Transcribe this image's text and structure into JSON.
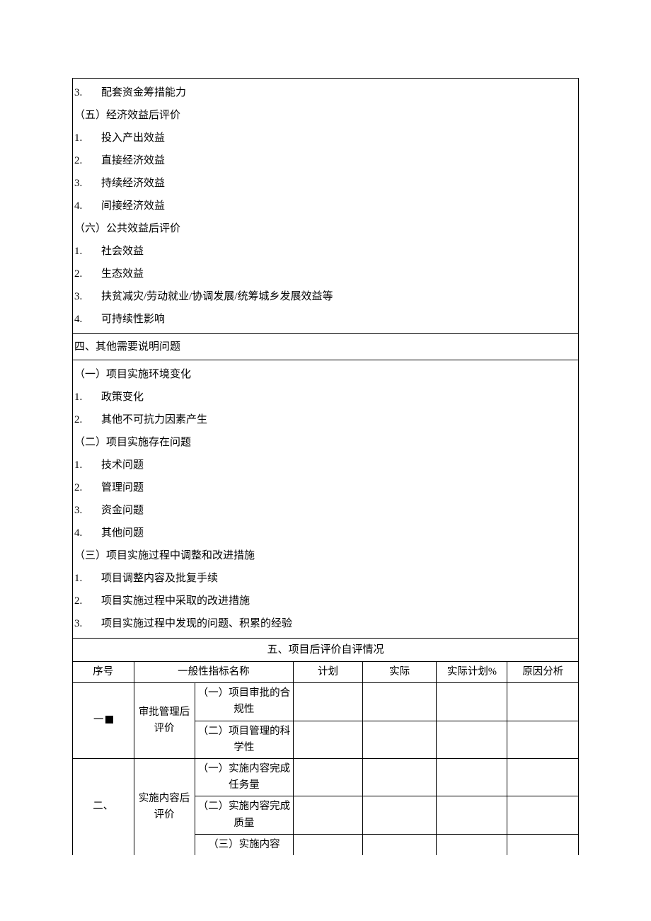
{
  "section3": {
    "item3": {
      "num": "3.",
      "text": "配套资金筹措能力"
    },
    "sub5": "（五）经济效益后评价",
    "s5_1": {
      "num": "1.",
      "text": "投入产出效益"
    },
    "s5_2": {
      "num": "2.",
      "text": "直接经济效益"
    },
    "s5_3": {
      "num": "3.",
      "text": "持续经济效益"
    },
    "s5_4": {
      "num": "4.",
      "text": "间接经济效益"
    },
    "sub6": "（六）公共效益后评价",
    "s6_1": {
      "num": "1.",
      "text": "社会效益"
    },
    "s6_2": {
      "num": "2.",
      "text": "生态效益"
    },
    "s6_3": {
      "num": "3.",
      "text": "扶贫减灾/劳动就业/协调发展/统筹城乡发展效益等"
    },
    "s6_4": {
      "num": "4.",
      "text": "可持续性影响"
    }
  },
  "section4": {
    "heading": "四、其他需要说明问题",
    "sub1": "（一）项目实施环境变化",
    "s1_1": {
      "num": "1.",
      "text": "政策变化"
    },
    "s1_2": {
      "num": "2.",
      "text": "其他不可抗力因素产生"
    },
    "sub2": "（二）项目实施存在问题",
    "s2_1": {
      "num": "1.",
      "text": "技术问题"
    },
    "s2_2": {
      "num": "2.",
      "text": "管理问题"
    },
    "s2_3": {
      "num": "3.",
      "text": "资金问题"
    },
    "s2_4": {
      "num": "4.",
      "text": "其他问题"
    },
    "sub3": "（三）项目实施过程中调整和改进措施",
    "s3_1": {
      "num": "1.",
      "text": "项目调整内容及批复手续"
    },
    "s3_2": {
      "num": "2.",
      "text": "项目实施过程中采取的改进措施"
    },
    "s3_3": {
      "num": "3.",
      "text": "项目实施过程中发现的问题、积累的经验"
    }
  },
  "section5": {
    "heading": "五、项目后评价自评情况",
    "headers": {
      "seq": "序号",
      "indicator": "一般性指标名称",
      "plan": "计划",
      "actual": "实际",
      "pct": "实际计划%",
      "reason": "原因分析"
    },
    "rows": [
      {
        "seq": "一",
        "category": "审批管理后评价",
        "indicators": [
          "（一）项目审批的合规性",
          "（二）项目管理的科学性"
        ],
        "marker": true
      },
      {
        "seq": "二、",
        "category": "实施内容后评价",
        "indicators": [
          "（一）实施内容完成任务量",
          "（二）实施内容完成质量",
          "（三）实施内容"
        ],
        "marker": false,
        "last": true
      }
    ]
  }
}
